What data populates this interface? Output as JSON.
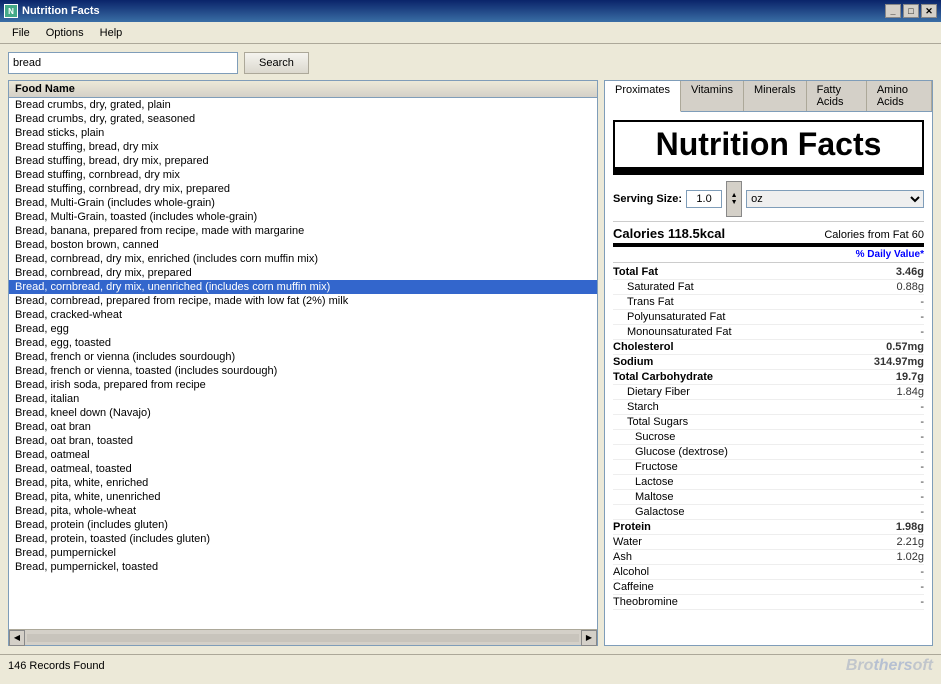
{
  "app": {
    "title": "Nutrition Facts",
    "icon": "N"
  },
  "title_controls": {
    "minimize": "_",
    "maximize": "□",
    "close": "✕"
  },
  "menu": {
    "items": [
      "File",
      "Options",
      "Help"
    ]
  },
  "search": {
    "input_value": "bread",
    "button_label": "Search"
  },
  "food_list": {
    "header": "Food Name",
    "items": [
      "Bread crumbs, dry, grated, plain",
      "Bread crumbs, dry, grated, seasoned",
      "Bread sticks, plain",
      "Bread stuffing, bread, dry mix",
      "Bread stuffing, bread, dry mix, prepared",
      "Bread stuffing, cornbread, dry mix",
      "Bread stuffing, cornbread, dry mix, prepared",
      "Bread, Multi-Grain (includes whole-grain)",
      "Bread, Multi-Grain, toasted (includes whole-grain)",
      "Bread, banana, prepared from recipe, made with margarine",
      "Bread, boston brown, canned",
      "Bread, cornbread, dry mix, enriched (includes corn muffin mix)",
      "Bread, cornbread, dry mix, prepared",
      "Bread, cornbread, dry mix, unenriched (includes corn muffin mix)",
      "Bread, cornbread, prepared from recipe, made with low fat (2%) milk",
      "Bread, cracked-wheat",
      "Bread, egg",
      "Bread, egg, toasted",
      "Bread, french or vienna (includes sourdough)",
      "Bread, french or vienna, toasted (includes sourdough)",
      "Bread, irish soda, prepared from recipe",
      "Bread, italian",
      "Bread, kneel down (Navajo)",
      "Bread, oat bran",
      "Bread, oat bran, toasted",
      "Bread, oatmeal",
      "Bread, oatmeal, toasted",
      "Bread, pita, white, enriched",
      "Bread, pita, white, unenriched",
      "Bread, pita, whole-wheat",
      "Bread, protein (includes gluten)",
      "Bread, protein, toasted (includes gluten)",
      "Bread, pumpernickel",
      "Bread, pumpernickel, toasted"
    ],
    "selected_index": 13
  },
  "tabs": [
    "Proximates",
    "Vitamins",
    "Minerals",
    "Fatty Acids",
    "Amino Acids"
  ],
  "active_tab": "Proximates",
  "nutrition": {
    "title": "Nutrition Facts",
    "serving_label": "Serving Size:",
    "serving_value": "1.0",
    "serving_unit": "oz",
    "calories_label": "Calories",
    "calories_value": "118.5kcal",
    "calories_from_fat_label": "Calories from Fat",
    "calories_from_fat_value": "60",
    "daily_value_header": "% Daily Value*",
    "nutrients": [
      {
        "label": "Total Fat",
        "value": "3.46g",
        "bold": true,
        "indent": 0
      },
      {
        "label": "  Saturated Fat",
        "value": "0.88g",
        "bold": false,
        "indent": 1
      },
      {
        "label": "  Trans Fat",
        "value": "-",
        "bold": false,
        "indent": 1
      },
      {
        "label": "  Polyunsaturated Fat",
        "value": "-",
        "bold": false,
        "indent": 1
      },
      {
        "label": "  Monounsaturated Fat",
        "value": "-",
        "bold": false,
        "indent": 1
      },
      {
        "label": "Cholesterol",
        "value": "0.57mg",
        "bold": true,
        "indent": 0
      },
      {
        "label": "Sodium",
        "value": "314.97mg",
        "bold": true,
        "indent": 0
      },
      {
        "label": "Total Carbohydrate",
        "value": "19.7g",
        "bold": true,
        "indent": 0
      },
      {
        "label": "  Dietary Fiber",
        "value": "1.84g",
        "bold": false,
        "indent": 1
      },
      {
        "label": "  Starch",
        "value": "-",
        "bold": false,
        "indent": 1
      },
      {
        "label": "  Total Sugars",
        "value": "-",
        "bold": false,
        "indent": 1
      },
      {
        "label": "    Sucrose",
        "value": "-",
        "bold": false,
        "indent": 2
      },
      {
        "label": "    Glucose (dextrose)",
        "value": "-",
        "bold": false,
        "indent": 2
      },
      {
        "label": "    Fructose",
        "value": "-",
        "bold": false,
        "indent": 2
      },
      {
        "label": "    Lactose",
        "value": "-",
        "bold": false,
        "indent": 2
      },
      {
        "label": "    Maltose",
        "value": "-",
        "bold": false,
        "indent": 2
      },
      {
        "label": "    Galactose",
        "value": "-",
        "bold": false,
        "indent": 2
      },
      {
        "label": "Protein",
        "value": "1.98g",
        "bold": true,
        "indent": 0
      },
      {
        "label": "Water",
        "value": "2.21g",
        "bold": false,
        "indent": 0
      },
      {
        "label": "Ash",
        "value": "1.02g",
        "bold": false,
        "indent": 0
      },
      {
        "label": "Alcohol",
        "value": "-",
        "bold": false,
        "indent": 0
      },
      {
        "label": "Caffeine",
        "value": "-",
        "bold": false,
        "indent": 0
      },
      {
        "label": "Theobromine",
        "value": "-",
        "bold": false,
        "indent": 0
      }
    ]
  },
  "status": {
    "records_text": "146 Records Found"
  },
  "branding": {
    "prefix": "Bro",
    "highlight": "thers",
    "suffix": "oft"
  }
}
